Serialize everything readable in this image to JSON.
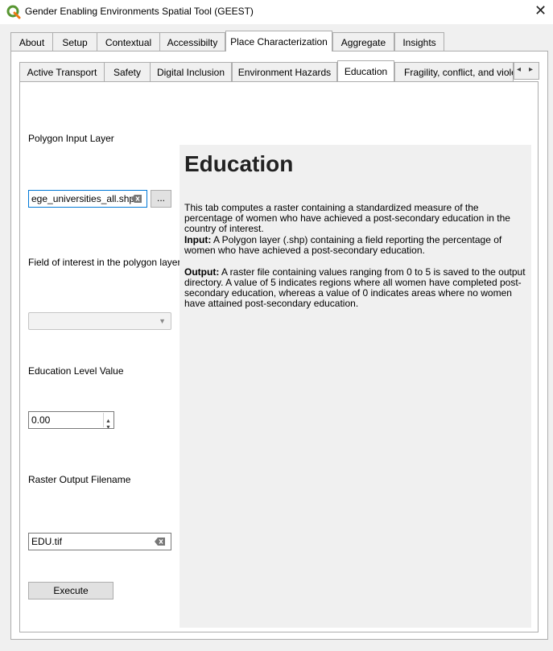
{
  "window": {
    "title": "Gender Enabling Environments Spatial Tool (GEEST)",
    "close_glyph": "✕",
    "icon": "qgis-logo-icon",
    "accent_color": "#589632"
  },
  "outer_tabs": [
    "About",
    "Setup",
    "Contextual",
    "Accessibilty",
    "Place Characterization",
    "Aggregate",
    "Insights"
  ],
  "outer_active": "Place Characterization",
  "inner_tabs": [
    "Active Transport",
    "Safety",
    "Digital Inclusion",
    "Environment Hazards",
    "Education",
    "Fragility, conflict, and violence"
  ],
  "inner_active": "Education",
  "form": {
    "polygon_label": "Polygon Input Layer",
    "polygon_value": "ege_universities_all.shp",
    "browse_label": "...",
    "field_label": "Field of interest in the polygon layer",
    "field_value": "",
    "edu_label": "Education Level Value",
    "edu_value": "0.00",
    "raster_label": "Raster Output Filename",
    "raster_value": "EDU.tif",
    "execute_label": "Execute"
  },
  "help": {
    "title": "Education",
    "intro": "This tab computes a raster containing a standardized measure of the percentage of women who have achieved a post-secondary education in the country of interest.",
    "input_heading": "Input:",
    "input_text": " A Polygon layer (.shp) containing a field reporting the percentage of women who have achieved a post-secondary education.",
    "output_heading": "Output:",
    "output_text": " A raster file containing values ranging from 0 to 5 is saved to the output directory. A value of 5 indicates regions where all women have completed post-secondary education, whereas a value of 0 indicates areas where no women have attained post-secondary education."
  }
}
